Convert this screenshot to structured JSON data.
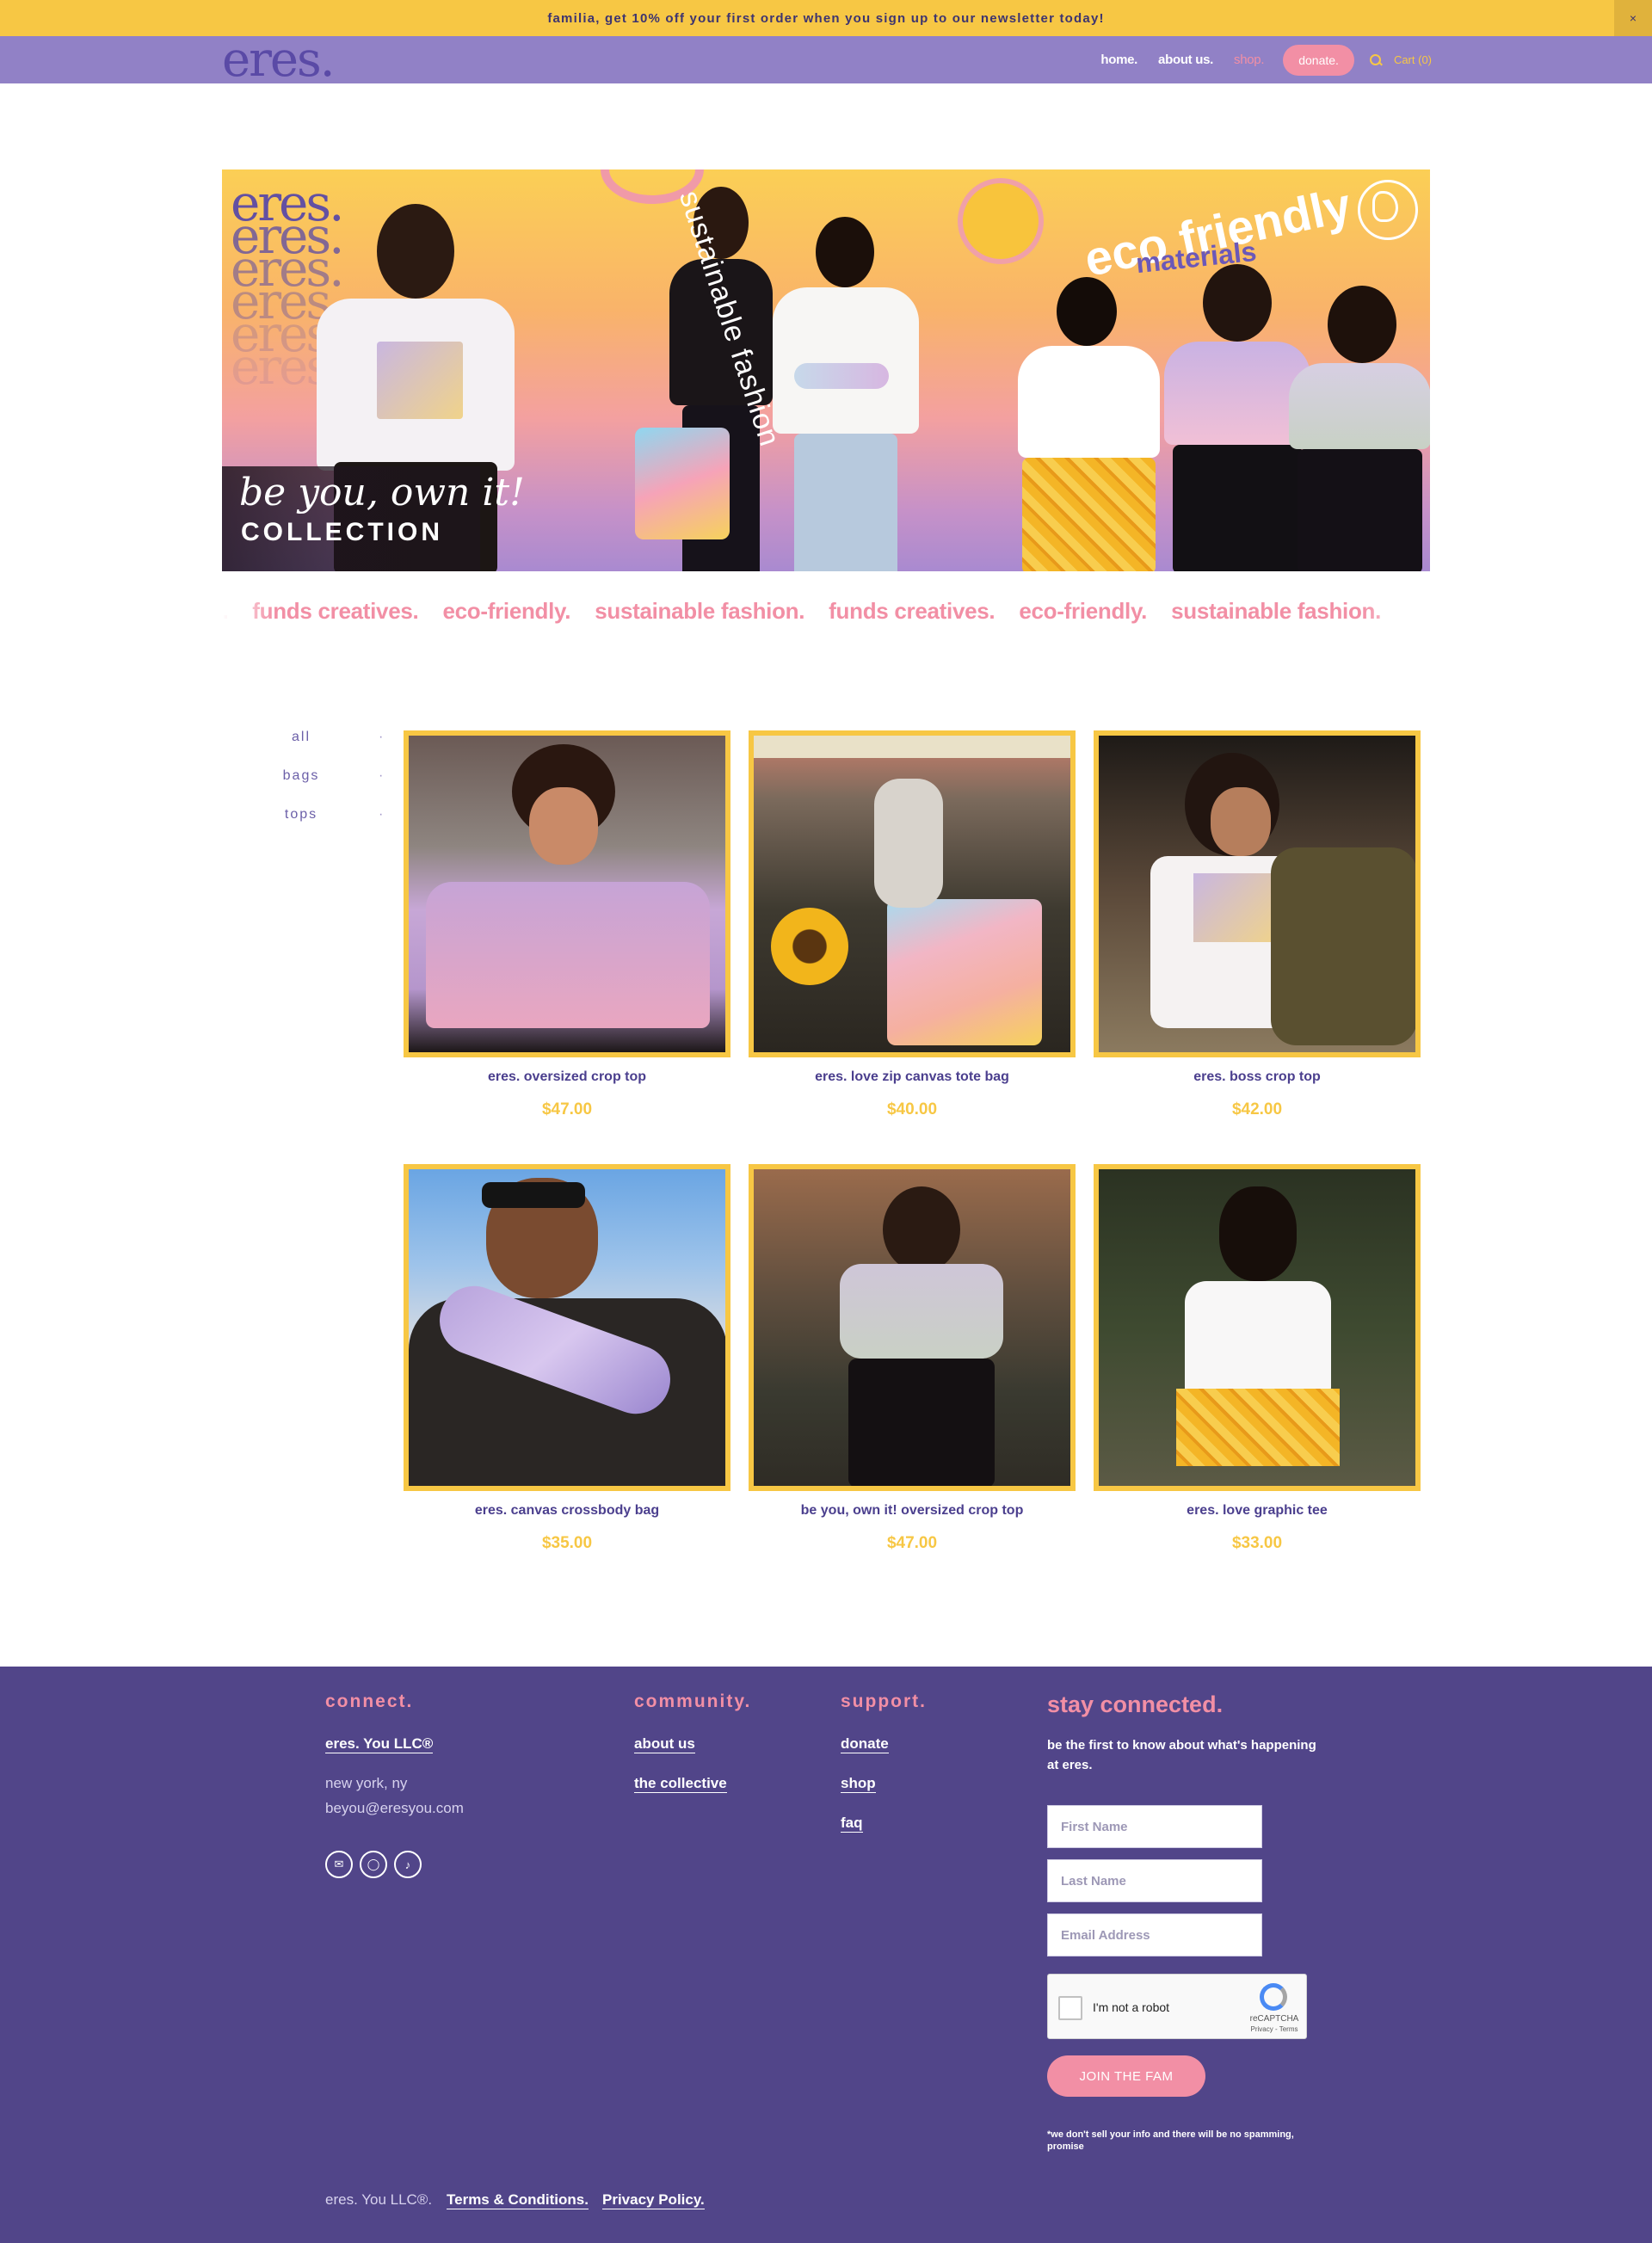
{
  "announcement": {
    "text": "familia, get 10% off your first order when you sign up to our newsletter today!",
    "close_label": "×"
  },
  "header": {
    "logo": "eres.",
    "nav": {
      "home": "home.",
      "about": "about us.",
      "shop": "shop.",
      "donate": "donate.",
      "cart": "Cart (0)"
    }
  },
  "hero": {
    "brand_stack": "eres.",
    "tagline_vertical": "sustainable fashion",
    "eco": "eco friendly",
    "materials": "materials",
    "collection_script": "be you, own it!",
    "collection_word": "COLLECTION"
  },
  "marquee": [
    "fashion.",
    "funds creatives.",
    "eco-friendly.",
    "sustainable fashion.",
    "funds creatives.",
    "eco-friendly.",
    "sustainable fashion."
  ],
  "filters": [
    {
      "label": "all",
      "dot": "·"
    },
    {
      "label": "bags",
      "dot": "·"
    },
    {
      "label": "tops",
      "dot": "·"
    }
  ],
  "products": [
    {
      "title": "eres. oversized crop top",
      "price": "$47.00"
    },
    {
      "title": "eres. love zip canvas tote bag",
      "price": "$40.00"
    },
    {
      "title": "eres. boss crop top",
      "price": "$42.00"
    },
    {
      "title": "eres. canvas crossbody bag",
      "price": "$35.00"
    },
    {
      "title": "be you, own it! oversized crop top",
      "price": "$47.00"
    },
    {
      "title": "eres. love graphic tee",
      "price": "$33.00"
    }
  ],
  "footer": {
    "connect": {
      "heading": "connect.",
      "company": "eres. You LLC®",
      "location": "new york, ny",
      "email": "beyou@eresyou.com",
      "social": [
        "email-icon",
        "instagram-icon",
        "tiktok-icon"
      ]
    },
    "community": {
      "heading": "community.",
      "links": [
        "about us",
        "the collective"
      ]
    },
    "support": {
      "heading": "support.",
      "links": [
        "donate",
        "shop",
        "faq"
      ]
    },
    "newsletter": {
      "heading": "stay connected.",
      "subtext": "be the first to know about what's happening at eres.",
      "first_name_placeholder": "First Name",
      "last_name_placeholder": "Last Name",
      "email_placeholder": "Email Address",
      "recaptcha_label": "I'm not a robot",
      "recaptcha_brand": "reCAPTCHA",
      "recaptcha_terms": "Privacy - Terms",
      "button": "JOIN THE FAM",
      "disclaimer": "*we don't sell your info and there will be no spamming, promise"
    },
    "bottom": {
      "copyright": "eres. You LLC®.",
      "terms": "Terms & Conditions.",
      "privacy": "Privacy Policy."
    }
  },
  "colors": {
    "announcement_bg": "#f7c744",
    "header_bg": "#9181c6",
    "accent_pink": "#f28fa5",
    "accent_yellow": "#f7c744",
    "footer_bg": "#514589",
    "text_purple": "#4b3f8e"
  }
}
